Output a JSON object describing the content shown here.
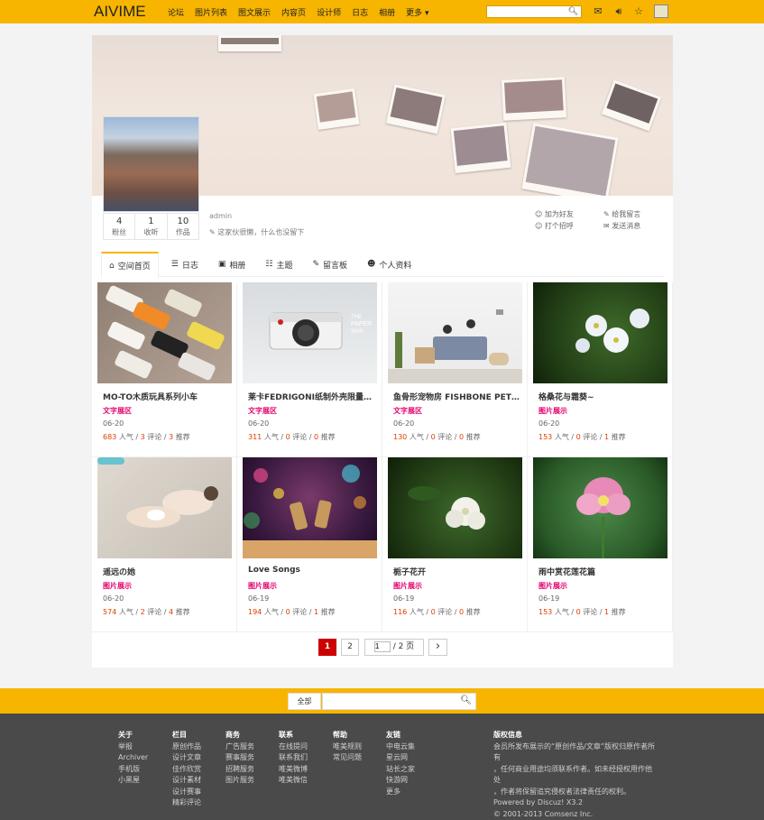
{
  "site": {
    "logo": "AIVIME",
    "nav": [
      "论坛",
      "图片列表",
      "图文展示",
      "内容页",
      "设计师",
      "日志",
      "相册",
      "更多 ▾"
    ]
  },
  "profile": {
    "stats": [
      {
        "num": "4",
        "label": "粉丝"
      },
      {
        "num": "1",
        "label": "收听"
      },
      {
        "num": "10",
        "label": "作品"
      }
    ],
    "username": "admin",
    "motto": "这家伙很懒，什么也没留下",
    "actions": {
      "add_friend": "加为好友",
      "leave_msg": "给我留言",
      "greet": "打个招呼",
      "send_msg": "发送消息"
    }
  },
  "tabs": [
    "空间首页",
    "日志",
    "相册",
    "主题",
    "留言板",
    "个人资料"
  ],
  "cards": [
    {
      "title": "MO-TO木质玩具系列小车",
      "cat": "文字展区",
      "date": "06-20",
      "views": "683",
      "comments": "3",
      "rec": "3"
    },
    {
      "title": "莱卡FEDRIGONI纸制外壳限量版...",
      "cat": "文字展区",
      "date": "06-20",
      "views": "311",
      "comments": "0",
      "rec": "0"
    },
    {
      "title": "鱼骨形宠物房 FISHBONE PET R...",
      "cat": "文字展区",
      "date": "06-20",
      "views": "130",
      "comments": "0",
      "rec": "0"
    },
    {
      "title": "格桑花与霜葵~",
      "cat": "图片展示",
      "date": "06-20",
      "views": "153",
      "comments": "0",
      "rec": "1"
    },
    {
      "title": "遥远の她",
      "cat": "图片展示",
      "date": "06-20",
      "views": "574",
      "comments": "2",
      "rec": "4"
    },
    {
      "title": "Love Songs",
      "cat": "图片展示",
      "date": "06-19",
      "views": "194",
      "comments": "0",
      "rec": "1"
    },
    {
      "title": "栀子花开",
      "cat": "图片展示",
      "date": "06-19",
      "views": "116",
      "comments": "0",
      "rec": "0"
    },
    {
      "title": "雨中赏花莲花篇",
      "cat": "图片展示",
      "date": "06-19",
      "views": "153",
      "comments": "0",
      "rec": "1"
    }
  ],
  "meta_labels": {
    "views": "人气",
    "comments": "评论",
    "rec": "推荐"
  },
  "pagination": {
    "page1": "1",
    "page2": "2",
    "input_value": "1",
    "total": "/ 2 页",
    "next": "›"
  },
  "footer": {
    "search_scope": "全部",
    "columns": [
      {
        "head": "关于",
        "items": [
          "举报",
          "Archiver",
          "手机版",
          "小黑屋"
        ]
      },
      {
        "head": "栏目",
        "items": [
          "原创作品",
          "设计文章",
          "佳作欣赏",
          "设计素材",
          "设计赛事",
          "精彩评论"
        ]
      },
      {
        "head": "商务",
        "items": [
          "广告服务",
          "赛事服务",
          "招聘服务",
          "图片服务"
        ]
      },
      {
        "head": "联系",
        "items": [
          "在线提问",
          "联系我们",
          "唯美微博",
          "唯美微信"
        ]
      },
      {
        "head": "帮助",
        "items": [
          "唯美规则",
          "常见问题"
        ]
      },
      {
        "head": "友链",
        "items": [
          "中电云集",
          "星云网",
          "站长之家",
          "快游网",
          "更多"
        ]
      }
    ],
    "copyright": {
      "head": "版权信息",
      "lines": [
        "会员所发布展示的“原创作品/文章”版权归原作者所有",
        "，任何商业用途均须联系作者。如未经授权用作他处",
        "，作者将保留追究侵权者法律责任的权利。",
        "Powered by Discuz! X3.2",
        "© 2001-2013 Comsenz Inc."
      ]
    }
  }
}
